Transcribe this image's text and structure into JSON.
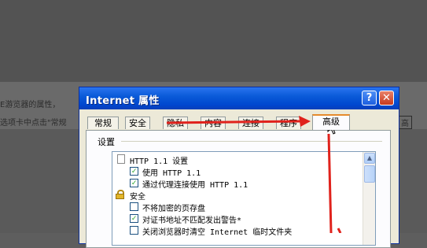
{
  "background": {
    "text_line_1": "E游览器的属性，",
    "text_line_2": "选项卡中点击\"常规",
    "text_right": "高"
  },
  "dialog": {
    "title": "Internet 属性",
    "help_glyph": "?",
    "close_glyph": "✕",
    "tabs": [
      {
        "label": "常规",
        "active": false
      },
      {
        "label": "安全",
        "active": false
      },
      {
        "label": "隐私",
        "active": false
      },
      {
        "label": "内容",
        "active": false
      },
      {
        "label": "连接",
        "active": false
      },
      {
        "label": "程序",
        "active": false
      },
      {
        "label": "高级",
        "active": true
      }
    ],
    "settings_label": "设置",
    "items": [
      {
        "type": "group",
        "icon": "page-icon",
        "label": "HTTP 1.1 设置"
      },
      {
        "type": "checkbox",
        "checked": true,
        "label": "使用 HTTP 1.1"
      },
      {
        "type": "checkbox",
        "checked": true,
        "label": "通过代理连接使用 HTTP 1.1"
      },
      {
        "type": "group",
        "icon": "lock-icon",
        "label": "安全"
      },
      {
        "type": "checkbox",
        "checked": false,
        "label": "不将加密的页存盘"
      },
      {
        "type": "checkbox",
        "checked": true,
        "label": "对证书地址不匹配发出警告*"
      },
      {
        "type": "checkbox",
        "checked": false,
        "label": "关闭浏览器时清空 Internet 临时文件夹"
      }
    ]
  },
  "colors": {
    "annotation_red": "#e0221c",
    "title_bar_blue": "#0a5bd8"
  }
}
